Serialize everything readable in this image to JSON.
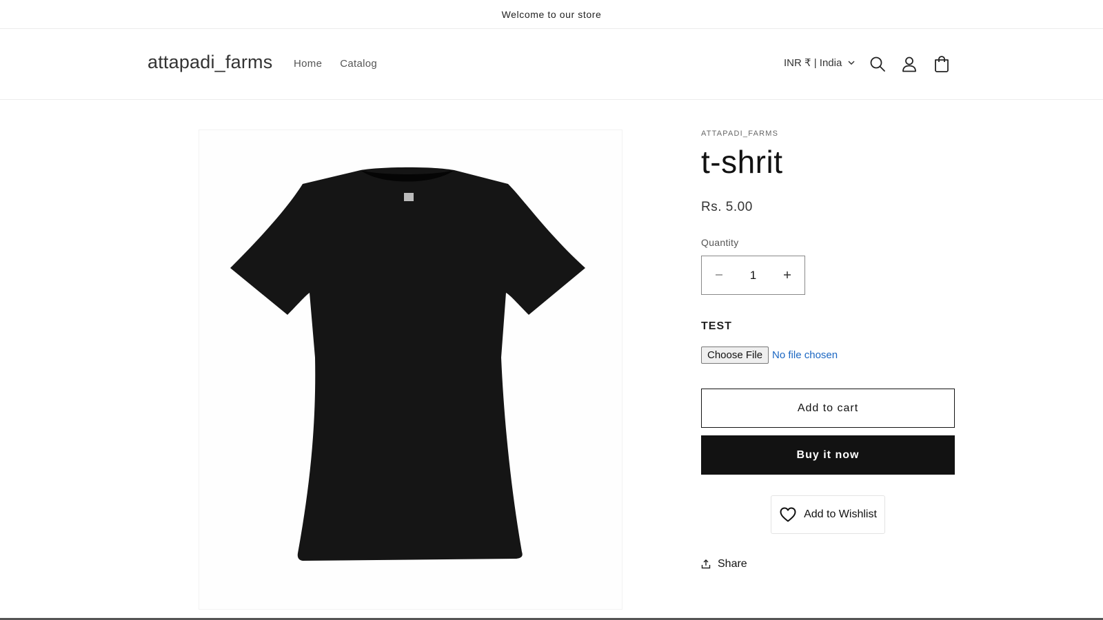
{
  "announcement": {
    "text": "Welcome to our store"
  },
  "header": {
    "logo": "attapadi_farms",
    "nav": [
      {
        "label": "Home"
      },
      {
        "label": "Catalog"
      }
    ],
    "localization": "INR ₹ | India",
    "icons": [
      "search-icon",
      "account-icon",
      "cart-icon"
    ]
  },
  "product": {
    "vendor": "ATTAPADI_FARMS",
    "title": "t-shrit",
    "price": "Rs. 5.00",
    "quantity_label": "Quantity",
    "quantity_value": "1",
    "custom_field_label": "TEST",
    "file_button": "Choose File",
    "file_status": "No file chosen",
    "add_to_cart": "Add to cart",
    "buy_now": "Buy it now",
    "wishlist": "Add to Wishlist",
    "share": "Share",
    "image_description_color": "#151515"
  }
}
